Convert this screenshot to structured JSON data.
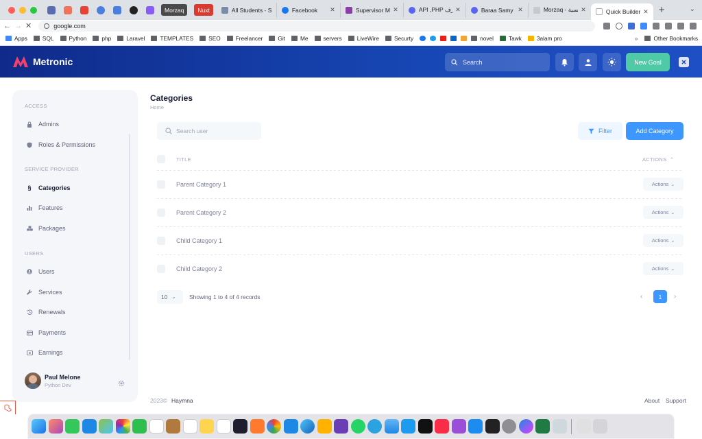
{
  "browser": {
    "pinned_tab_badges": [
      "Morzaq",
      "Nuxt"
    ],
    "tabs": [
      {
        "title": "All Students - S",
        "color": "#7b8ca8"
      },
      {
        "title": "Facebook",
        "color": "#1877f2"
      },
      {
        "title": "Supervisor Ma",
        "color": "#8a3ea6"
      },
      {
        "title": "API ,PHP محترف",
        "color": "#5865f2"
      },
      {
        "title": "Baraa Samy | ...",
        "color": "#5865f2"
      },
      {
        "title": "Morzaq - الرئيسية",
        "color": "#c9c9c9"
      },
      {
        "title": "Quick Builder",
        "color": "#999999"
      }
    ],
    "url": "google.com",
    "bookmarks": [
      "Apps",
      "SQL",
      "Python",
      "php",
      "Laravel",
      "TEMPLATES",
      "SEO",
      "Freelancer",
      "Git",
      "Me",
      "servers",
      "LiveWire",
      "Securty",
      "novel",
      "Tawk",
      "3alam pro"
    ],
    "other_bookmarks": "Other Bookmarks"
  },
  "header": {
    "brand": "Metronic",
    "search_placeholder": "Search",
    "new_goal_label": "New Goal"
  },
  "sidebar": {
    "sections": [
      {
        "title": "ACCESS",
        "items": [
          {
            "label": "Admins",
            "icon": "lock-icon"
          },
          {
            "label": "Roles & Permissions",
            "icon": "shield-icon"
          }
        ]
      },
      {
        "title": "SERVICE PROVIDER",
        "items": [
          {
            "label": "Categories",
            "icon": "section-icon",
            "active": true
          },
          {
            "label": "Features",
            "icon": "bar-chart-icon"
          },
          {
            "label": "Packages",
            "icon": "cubes-icon"
          }
        ]
      },
      {
        "title": "USERS",
        "items": [
          {
            "label": "Users",
            "icon": "user-icon"
          },
          {
            "label": "Services",
            "icon": "wrench-icon"
          },
          {
            "label": "Renewals",
            "icon": "history-icon"
          },
          {
            "label": "Payments",
            "icon": "card-icon"
          },
          {
            "label": "Earnings",
            "icon": "money-icon"
          }
        ]
      }
    ],
    "user": {
      "name": "Paul Melone",
      "role": "Python Dev"
    }
  },
  "main": {
    "title": "Categories",
    "breadcrumb": "Home",
    "search_placeholder": "Search user",
    "filter_label": "Filter",
    "add_label": "Add Category",
    "table": {
      "columns": [
        "TITLE",
        "ACTIONS"
      ],
      "rows": [
        "Parent Category 1",
        "Parent Category 2",
        "Child Category 1",
        "Child Category 2"
      ],
      "actions_label": "Actions"
    },
    "pagination": {
      "page_size": "10",
      "summary": "Showing 1 to 4 of 4 records",
      "current_page": "1"
    }
  },
  "footer": {
    "year": "2023©",
    "brand": "Haymna",
    "links": [
      "About",
      "Support"
    ]
  },
  "colors": {
    "header_gradient_start": "#0f2a8a",
    "header_gradient_end": "#1f4fc5",
    "primary": "#3e97ff",
    "success": "#4fc9a6",
    "sidebar_bg": "#f5f6fa"
  }
}
